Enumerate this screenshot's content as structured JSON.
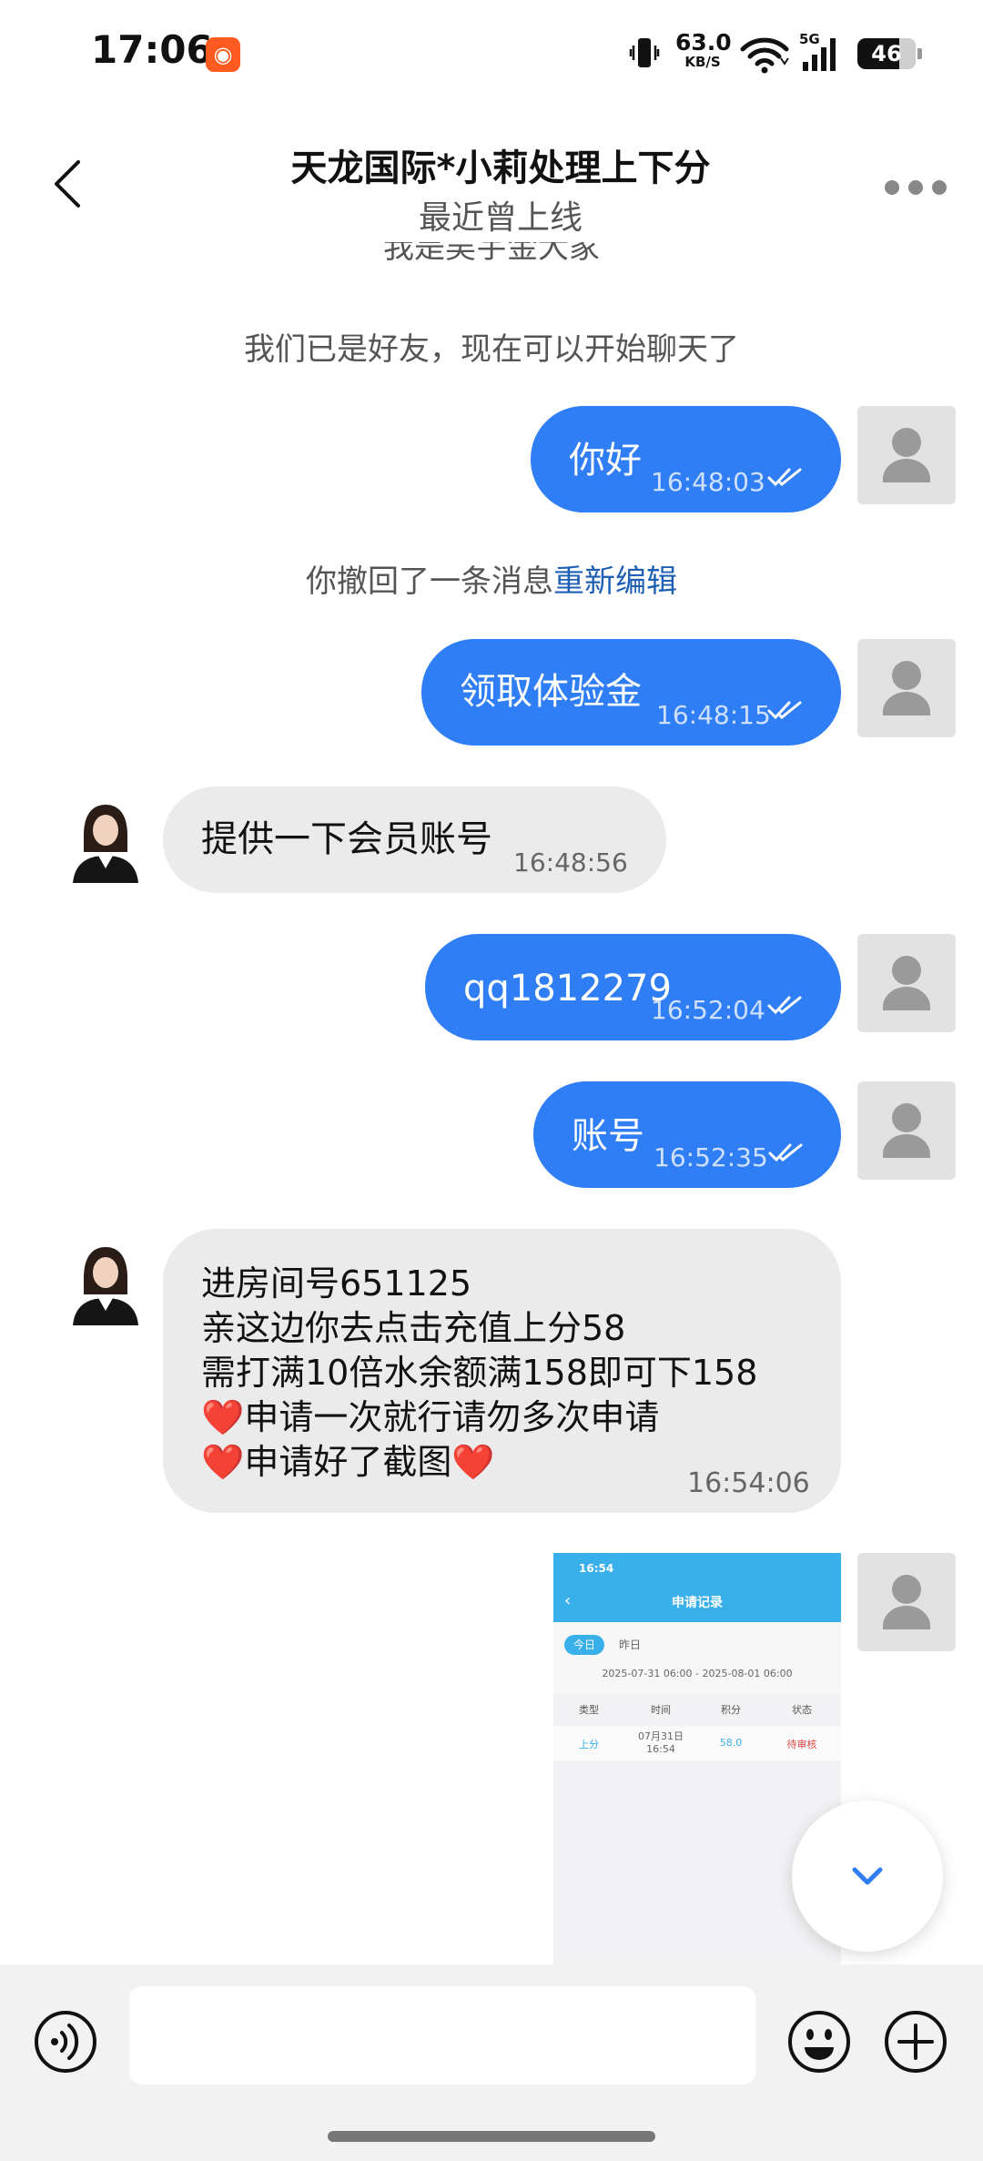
{
  "status_bar": {
    "time": "17:06",
    "network_speed_value": "63.0",
    "network_speed_unit": "KB/S",
    "network_type": "5G",
    "battery": "46"
  },
  "header": {
    "title": "天龙国际*小莉处理上下分",
    "subtitle": "最近曾上线"
  },
  "chat": {
    "partial_system_text": "我是吴宇金大家",
    "friend_notice": "我们已是好友，现在可以开始聊天了",
    "recall_notice": "你撤回了一条消息",
    "recall_edit_link": "重新编辑",
    "messages": [
      {
        "side": "out",
        "text": "你好",
        "time": "16:48:03"
      },
      {
        "side": "out",
        "text": "领取体验金",
        "time": "16:48:15"
      },
      {
        "side": "in",
        "text": "提供一下会员账号",
        "time": "16:48:56"
      },
      {
        "side": "out",
        "text": "qq1812279",
        "time": "16:52:04"
      },
      {
        "side": "out",
        "text": "账号",
        "time": "16:52:35"
      },
      {
        "side": "in",
        "lines": [
          "进房间号651125",
          "亲这边你去点击充值上分58",
          "需打满10倍水余额满158即可下158",
          "❤️申请一次就行请勿多次申请",
          "❤️申请好了截图❤️"
        ],
        "time": "16:54:06"
      }
    ],
    "screenshot": {
      "status_time": "16:54",
      "title": "申请记录",
      "tab_today": "今日",
      "tab_yesterday": "昨日",
      "date_range": "2025-07-31 06:00 - 2025-08-01 06:00",
      "columns": [
        "类型",
        "时间",
        "积分",
        "状态"
      ],
      "row": {
        "type": "上分",
        "time_line1": "07月31日",
        "time_line2": "16:54",
        "points": "58.0",
        "status": "待审核"
      }
    }
  },
  "colors": {
    "outgoing_bubble": "#2f7ef6",
    "incoming_bubble": "#ebebeb",
    "link": "#1e5fb3"
  },
  "icons": [
    "back-arrow-icon",
    "more-dots-icon",
    "double-check-icon",
    "voice-icon",
    "emoji-icon",
    "plus-icon",
    "chevron-down-icon",
    "user-icon"
  ]
}
